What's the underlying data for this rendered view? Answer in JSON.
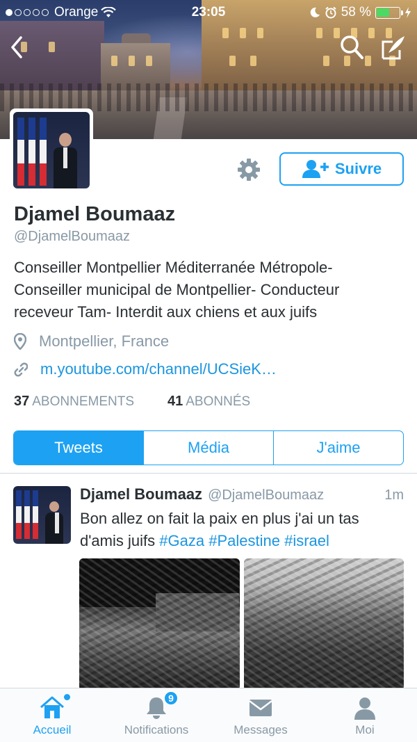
{
  "status_bar": {
    "carrier": "Orange",
    "time": "23:05",
    "battery_percent": "58 %",
    "battery_level": 0.58
  },
  "profile": {
    "name": "Djamel Boumaaz",
    "handle": "@DjamelBoumaaz",
    "bio": "Conseiller Montpellier Méditerranée Métropole- Conseiller municipal de Montpellier- Conducteur receveur Tam- Interdit aux chiens et aux juifs",
    "location": "Montpellier, France",
    "website": "m.youtube.com/channel/UCSieK…",
    "following_count": "37",
    "following_label": "ABONNEMENTS",
    "followers_count": "41",
    "followers_label": "ABONNÉS",
    "follow_button": "Suivre"
  },
  "tabs": [
    "Tweets",
    "Média",
    "J'aime"
  ],
  "active_tab": "Tweets",
  "tweet": {
    "name": "Djamel Boumaaz",
    "handle": "@DjamelBoumaaz",
    "time": "1m",
    "text_before": "Bon allez on fait la paix en plus j'ai un tas d'amis juifs",
    "hashtags": [
      "#Gaza",
      "#Palestine",
      "#israel"
    ]
  },
  "tabbar": {
    "home": "Accueil",
    "notifications": "Notifications",
    "notifications_badge": "9",
    "messages": "Messages",
    "me": "Moi"
  },
  "colors": {
    "accent": "#1da1f2",
    "link": "#1b95e0",
    "muted": "#8899a6",
    "text": "#292f33"
  }
}
